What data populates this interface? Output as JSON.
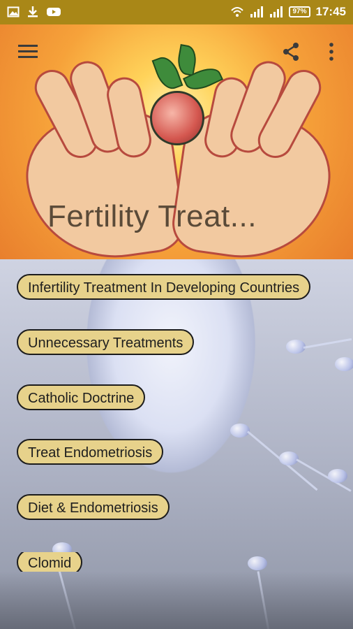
{
  "status_bar": {
    "time": "17:45",
    "battery": "97",
    "left_icons": [
      "image-icon",
      "download-icon",
      "youtube-icon"
    ],
    "right_icons": [
      "wifi-icon",
      "signal-icon",
      "signal-icon",
      "battery-icon"
    ]
  },
  "header": {
    "title": "Fertility Treat...",
    "menu_icon": "menu-icon",
    "share_icon": "share-icon",
    "more_icon": "more-vert-icon"
  },
  "menu": {
    "items": [
      {
        "label": "Infertility Treatment In Developing Countries"
      },
      {
        "label": "Unnecessary Treatments"
      },
      {
        "label": "Catholic Doctrine"
      },
      {
        "label": "Treat Endometriosis"
      },
      {
        "label": "Diet & Endometriosis"
      },
      {
        "label": "Clomid"
      }
    ]
  },
  "colors": {
    "status_bar": "#a98717",
    "button_fill": "#e7d28b",
    "button_border": "#1c1c1c"
  }
}
